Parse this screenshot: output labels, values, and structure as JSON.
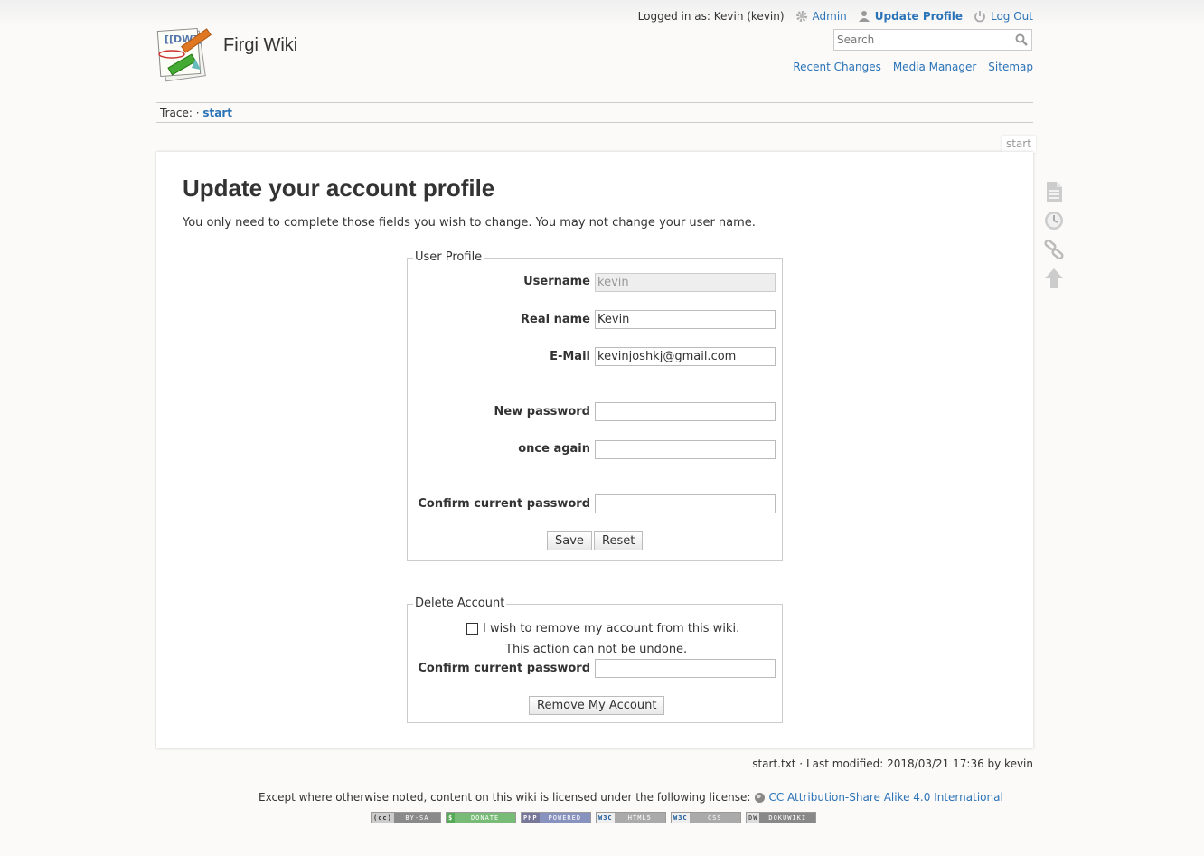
{
  "header": {
    "logged_in_text": "Logged in as: Kevin (kevin)",
    "admin": "Admin",
    "update_profile": "Update Profile",
    "logout": "Log Out",
    "wiki_title": "Firgi Wiki",
    "search_placeholder": "Search",
    "site_tools": [
      "Recent Changes",
      "Media Manager",
      "Sitemap"
    ]
  },
  "breadcrumb": {
    "label": "Trace:",
    "separator": "·",
    "current": "start"
  },
  "page": {
    "page_id": "start",
    "title": "Update your account profile",
    "intro": "You only need to complete those fields you wish to change. You may not change your user name."
  },
  "profile_form": {
    "legend": "User Profile",
    "username_label": "Username",
    "username_value": "kevin",
    "realname_label": "Real name",
    "realname_value": "Kevin",
    "email_label": "E-Mail",
    "email_value": "kevinjoshkj@gmail.com",
    "newpass_label": "New password",
    "newpass_value": "",
    "oncemore_label": "once again",
    "oncemore_value": "",
    "confirm_label": "Confirm current password",
    "confirm_value": "",
    "save_label": "Save",
    "reset_label": "Reset"
  },
  "delete_form": {
    "legend": "Delete Account",
    "checkbox_label": "I wish to remove my account from this wiki.",
    "checkbox_checked": false,
    "warning": "This action can not be undone.",
    "confirm_label": "Confirm current password",
    "confirm_value": "",
    "remove_label": "Remove My Account"
  },
  "page_tools": [
    "document-icon",
    "history-clock-icon",
    "backlinks-chain-icon",
    "back-to-top-arrow-icon"
  ],
  "footer": {
    "docinfo": "start.txt · Last modified: 2018/03/21 17:36 by kevin",
    "license_text": "Except where otherwise noted, content on this wiki is licensed under the following license:",
    "license_link": "CC Attribution-Share Alike 4.0 International",
    "badges": [
      {
        "left": "(cc)",
        "right": "BY-SA"
      },
      {
        "left": "$",
        "right": "DONATE"
      },
      {
        "left": "PHP",
        "right": "POWERED"
      },
      {
        "left": "W3C",
        "right": "HTML5"
      },
      {
        "left": "W3C",
        "right": "CSS"
      },
      {
        "left": "DW",
        "right": "DOKUWIKI"
      }
    ]
  },
  "colors": {
    "link": "#2b73b7",
    "text": "#333333",
    "border": "#cccccc"
  }
}
